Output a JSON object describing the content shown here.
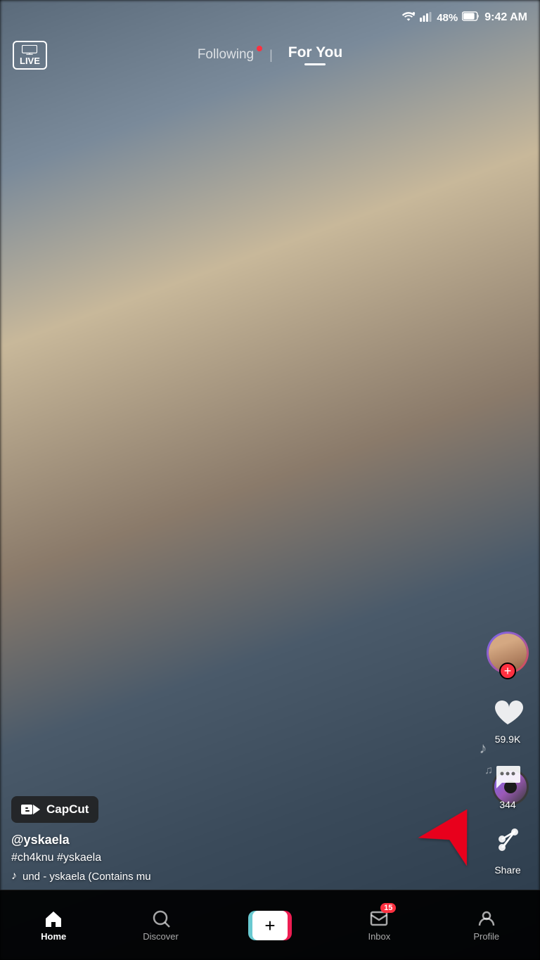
{
  "statusBar": {
    "battery": "48%",
    "time": "9:42 AM"
  },
  "topNav": {
    "liveLabel": "LIVE",
    "followingLabel": "Following",
    "forYouLabel": "For You"
  },
  "rightActions": {
    "likeCount": "59.9K",
    "commentCount": "344",
    "shareLabel": "Share"
  },
  "bottomContent": {
    "capcut": "CapCut",
    "username": "@yskaela",
    "hashtags": "#ch4knu #yskaela",
    "musicNote": "♪",
    "songInfo": "und - yskaela (Contains mu"
  },
  "bottomNav": {
    "homeLabel": "Home",
    "discoverLabel": "Discover",
    "inboxLabel": "Inbox",
    "profileLabel": "Profile",
    "inboxBadge": "15"
  }
}
